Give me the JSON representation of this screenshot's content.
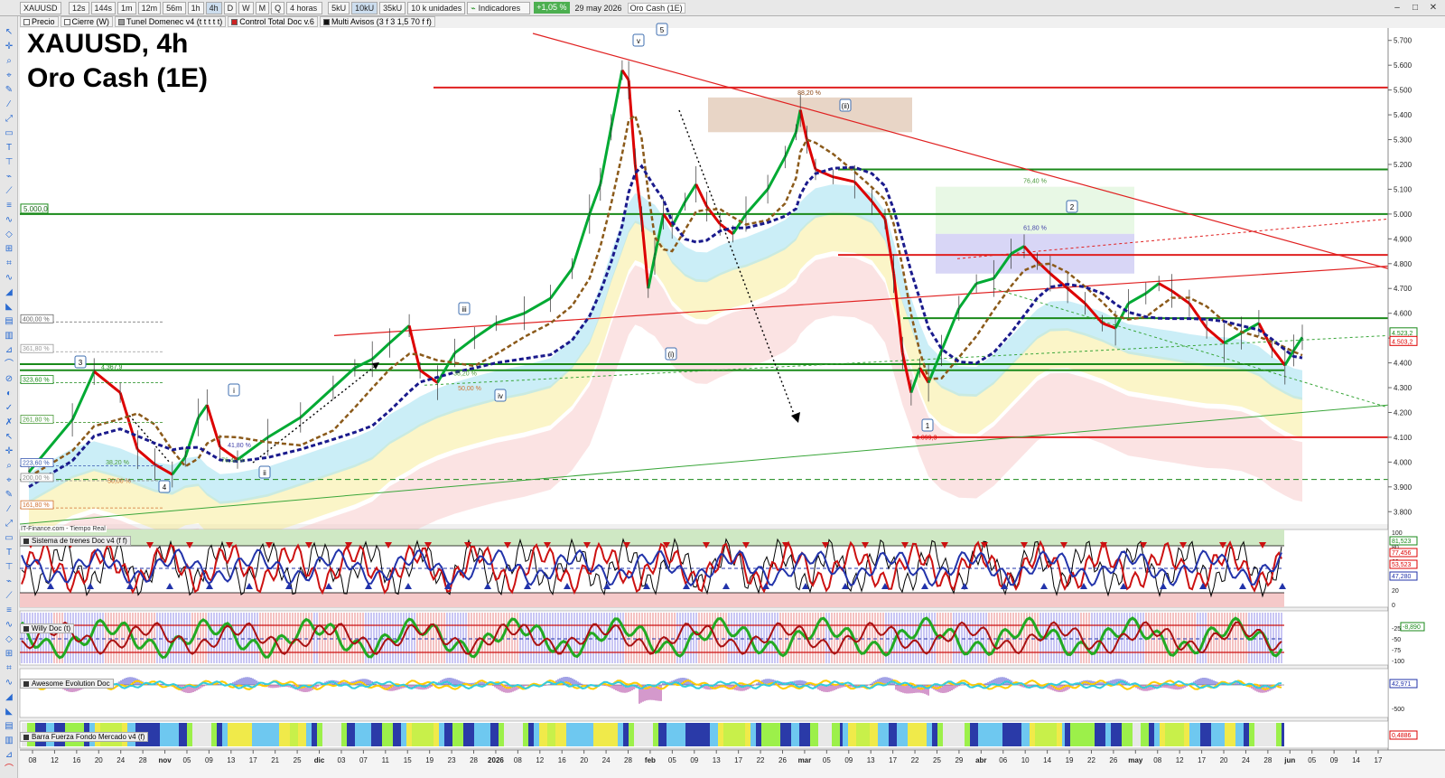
{
  "window": {
    "symbol": "XAUUSD",
    "timeframes": [
      "12s",
      "144s",
      "1m",
      "12m",
      "56m",
      "1h",
      "4h",
      "D",
      "W",
      "M",
      "Q"
    ],
    "active_timeframe": "4h",
    "period_select": "4 horas",
    "volume_buttons": [
      "5kU",
      "10kU",
      "35kU"
    ],
    "active_volume": "10kU",
    "units_select": "10 k unidades",
    "indicators_label": "Indicadores",
    "change_pct": "+1,05 %",
    "date": "29 may 2026",
    "instrument_name": "Oro Cash (1E)",
    "controls": [
      "–",
      "□",
      "✕"
    ]
  },
  "indicator_bar": [
    {
      "label": "Precio",
      "color": "#ffffff"
    },
    {
      "label": "Cierre (W)",
      "color": "#ffffff"
    },
    {
      "label": "Tunel Domenec v4 (t t t t t)",
      "color": "#999999"
    },
    {
      "label": "Control Total Doc v.6",
      "color": "#cc2222"
    },
    {
      "label": "Multi Avisos (3 f 3 1,5 70 f f)",
      "color": "#111111"
    }
  ],
  "title": {
    "line1": "XAUUSD, 4h",
    "line2": "Oro Cash (1E)"
  },
  "source": "IT-Finance.com - Tiempo Real",
  "colors": {
    "up": "#00aa33",
    "down": "#dd0000",
    "resistance": "#e02020",
    "support": "#1a8a1a"
  },
  "chart_data": {
    "type": "line",
    "title": "XAUUSD, 4h",
    "subtitle": "Oro Cash (1E)",
    "y_axis": {
      "min": 3750,
      "max": 5750,
      "ticks": [
        3800,
        3900,
        4000,
        4100,
        4200,
        4300,
        4400,
        4500,
        4600,
        4700,
        4800,
        4900,
        5000,
        5100,
        5200,
        5300,
        5400,
        5500,
        5600,
        5700
      ],
      "tick_labels": [
        "3.800",
        "3.900",
        "4.000",
        "4.100",
        "4.200",
        "4.300",
        "4.400",
        "4.500",
        "4.600",
        "4.700",
        "4.800",
        "4.900",
        "5.000",
        "5.100",
        "5.200",
        "5.300",
        "5.400",
        "5.500",
        "5.600",
        "5.700"
      ]
    },
    "x_axis": {
      "labels": [
        "08",
        "12",
        "16",
        "20",
        "24",
        "28",
        "nov",
        "05",
        "09",
        "13",
        "17",
        "21",
        "25",
        "dic",
        "03",
        "07",
        "11",
        "15",
        "19",
        "23",
        "28",
        "2026",
        "08",
        "12",
        "16",
        "20",
        "24",
        "28",
        "feb",
        "05",
        "09",
        "13",
        "17",
        "22",
        "26",
        "mar",
        "05",
        "09",
        "13",
        "17",
        "22",
        "25",
        "29",
        "abr",
        "06",
        "10",
        "14",
        "19",
        "22",
        "26",
        "may",
        "08",
        "12",
        "17",
        "20",
        "24",
        "28",
        "jun",
        "05",
        "09",
        "14",
        "17"
      ]
    },
    "price_path": [
      [
        0,
        3960
      ],
      [
        20,
        4170
      ],
      [
        30,
        4365
      ],
      [
        42,
        4280
      ],
      [
        50,
        4050
      ],
      [
        58,
        3990
      ],
      [
        66,
        3950
      ],
      [
        72,
        4020
      ],
      [
        78,
        4180
      ],
      [
        82,
        4230
      ],
      [
        88,
        4060
      ],
      [
        96,
        4010
      ],
      [
        110,
        4100
      ],
      [
        125,
        4180
      ],
      [
        140,
        4300
      ],
      [
        150,
        4380
      ],
      [
        158,
        4415
      ],
      [
        166,
        4480
      ],
      [
        175,
        4550
      ],
      [
        180,
        4370
      ],
      [
        188,
        4320
      ],
      [
        196,
        4440
      ],
      [
        205,
        4500
      ],
      [
        215,
        4560
      ],
      [
        228,
        4600
      ],
      [
        240,
        4660
      ],
      [
        250,
        4780
      ],
      [
        258,
        5000
      ],
      [
        263,
        5120
      ],
      [
        268,
        5350
      ],
      [
        273,
        5580
      ],
      [
        276,
        5540
      ],
      [
        279,
        5200
      ],
      [
        282,
        4980
      ],
      [
        285,
        4700
      ],
      [
        288,
        4830
      ],
      [
        292,
        5000
      ],
      [
        296,
        4950
      ],
      [
        302,
        5050
      ],
      [
        307,
        5120
      ],
      [
        312,
        5030
      ],
      [
        318,
        4960
      ],
      [
        324,
        4920
      ],
      [
        330,
        5000
      ],
      [
        340,
        5100
      ],
      [
        348,
        5230
      ],
      [
        353,
        5330
      ],
      [
        355,
        5420
      ],
      [
        358,
        5300
      ],
      [
        362,
        5180
      ],
      [
        370,
        5150
      ],
      [
        380,
        5130
      ],
      [
        388,
        5050
      ],
      [
        394,
        4980
      ],
      [
        398,
        4760
      ],
      [
        402,
        4440
      ],
      [
        406,
        4280
      ],
      [
        410,
        4380
      ],
      [
        414,
        4320
      ],
      [
        420,
        4450
      ],
      [
        428,
        4620
      ],
      [
        436,
        4720
      ],
      [
        444,
        4740
      ],
      [
        452,
        4840
      ],
      [
        458,
        4870
      ],
      [
        464,
        4810
      ],
      [
        470,
        4760
      ],
      [
        478,
        4700
      ],
      [
        486,
        4640
      ],
      [
        494,
        4560
      ],
      [
        500,
        4540
      ],
      [
        506,
        4640
      ],
      [
        514,
        4680
      ],
      [
        520,
        4720
      ],
      [
        526,
        4690
      ],
      [
        534,
        4640
      ],
      [
        542,
        4540
      ],
      [
        550,
        4480
      ],
      [
        558,
        4520
      ],
      [
        566,
        4560
      ],
      [
        572,
        4460
      ],
      [
        578,
        4390
      ],
      [
        582,
        4450
      ],
      [
        586,
        4503
      ]
    ],
    "horizontal_levels": [
      {
        "price": 5510,
        "color": "#e02020",
        "label": ""
      },
      {
        "price": 5180,
        "color": "#1a8a1a",
        "label": ""
      },
      {
        "price": 5000,
        "color": "#1a8a1a",
        "label": "5.000,0"
      },
      {
        "price": 4835,
        "color": "#e02020",
        "label": ""
      },
      {
        "price": 4580,
        "color": "#1a8a1a",
        "label": ""
      },
      {
        "price": 4395,
        "color": "#1a8a1a",
        "label": ""
      },
      {
        "price": 4370,
        "color": "#1a8a1a",
        "label": ""
      },
      {
        "price": 4100,
        "color": "#e02020",
        "label": "4.099,3"
      },
      {
        "price": 3930,
        "color": "#1a8a1a",
        "label": ""
      }
    ],
    "fib_labels": [
      "88,20 %",
      "76,40 %",
      "61,80 %",
      "38,20 %",
      "50,00 %",
      "41,80 %",
      "76,40 %",
      "38,20 %",
      "50,00 %"
    ],
    "fib_side_labels": [
      "400,00 %",
      "361,80 %",
      "323,60 %",
      "261,80 %",
      "223,60 %",
      "200,00 %",
      "161,80 %"
    ],
    "annotations": [
      "4.367,9",
      "4.099,3"
    ],
    "wave_labels": [
      "v",
      "5",
      "(ii)",
      "2",
      "iii",
      "(i)",
      "3",
      "i",
      "ii",
      "iv",
      "4",
      "1"
    ],
    "last_price_labels": [
      "4.523,2",
      "4.503,2"
    ],
    "indicators": [
      {
        "name": "Sistema de trenes Doc v4 (f f)",
        "scale": [
          "100",
          "80",
          "60",
          "40",
          "20",
          "0"
        ],
        "values": [
          "81,523",
          "77,456",
          "53,523",
          "47,280"
        ]
      },
      {
        "name": "Willy Doc (t)",
        "scale": [
          "-25",
          "-50",
          "-75",
          "-100"
        ],
        "values": [
          "-8,890"
        ]
      },
      {
        "name": "Awesome Evolution Doc",
        "scale": [
          "0",
          "-500"
        ],
        "values": [
          "42,971"
        ]
      },
      {
        "name": "Barra Fuerza Fondo Mercado v4 (f)",
        "scale": [],
        "values": [
          "0,4886"
        ]
      }
    ]
  }
}
